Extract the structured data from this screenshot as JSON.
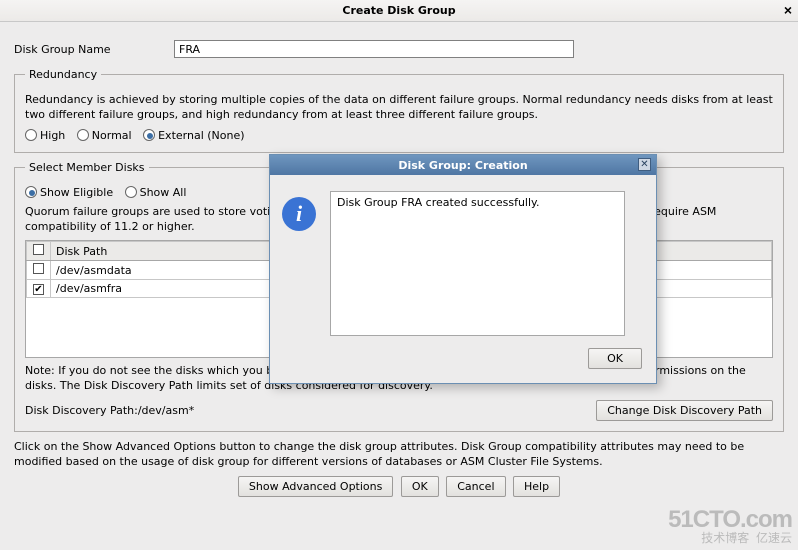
{
  "window": {
    "title": "Create Disk Group",
    "close_glyph": "×"
  },
  "form": {
    "disk_group_name_label": "Disk Group Name",
    "disk_group_name_value": "FRA"
  },
  "redundancy": {
    "legend": "Redundancy",
    "description": "Redundancy is achieved by storing multiple copies of the data on different failure groups. Normal redundancy needs disks from at least two different failure groups, and high redundancy from at least three different failure groups.",
    "options": {
      "high": "High",
      "normal": "Normal",
      "external": "External (None)"
    },
    "selected": "external"
  },
  "member_disks": {
    "legend": "Select Member Disks",
    "show_options": {
      "eligible": "Show Eligible",
      "all": "Show All"
    },
    "show_selected": "eligible",
    "quorum_note": "Quorum failure groups are used to store voting files in extended clusters and do not contain any user data. They require ASM compatibility of 11.2 or higher.",
    "table": {
      "header_disk_path": "Disk Path",
      "rows": [
        {
          "checked": false,
          "path": "/dev/asmdata"
        },
        {
          "checked": true,
          "path": "/dev/asmfra"
        }
      ]
    },
    "post_note": "Note: If you do not see the disks which you believe are available, check the Disk Discovery Path and read/write permissions on the disks. The Disk Discovery Path limits set of disks considered for discovery.",
    "discovery_label": "Disk Discovery Path:/dev/asm*",
    "change_path_btn": "Change Disk Discovery Path"
  },
  "advanced_note": "Click on the Show Advanced Options button to change the disk group attributes. Disk Group compatibility attributes may need to be modified based on the usage of disk group for different versions of databases or ASM Cluster File Systems.",
  "footer": {
    "advanced": "Show Advanced Options",
    "ok": "OK",
    "cancel": "Cancel",
    "help": "Help"
  },
  "modal": {
    "title": "Disk Group: Creation",
    "close_glyph": "✕",
    "info_glyph": "i",
    "message": "Disk Group FRA created successfully.",
    "ok": "OK"
  },
  "watermark": {
    "big": "51CTO.com",
    "sub1": "技术博客",
    "sub2": "亿速云"
  }
}
